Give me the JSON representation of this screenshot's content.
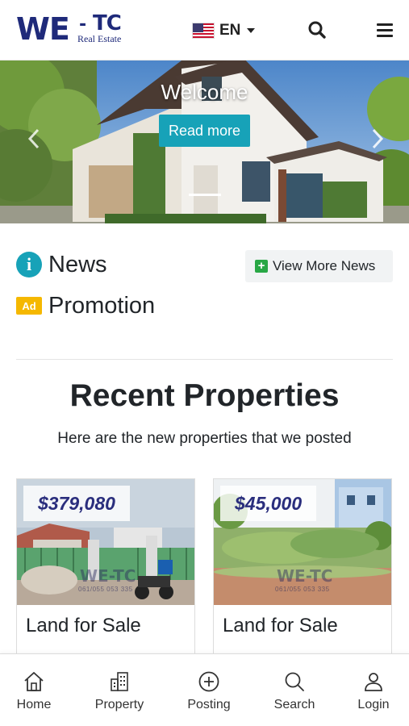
{
  "header": {
    "logo": {
      "main": "WE",
      "dash": "-",
      "tc": "TC",
      "sub": "Real Estate"
    },
    "language": {
      "selected": "EN",
      "flag": "us-flag"
    },
    "icons": {
      "search": "search-icon",
      "menu": "hamburger-menu-icon"
    }
  },
  "hero": {
    "title": "Welcome",
    "button_label": "Read more",
    "prev_icon": "chevron-left-icon",
    "next_icon": "chevron-right-icon"
  },
  "news": {
    "label": "News",
    "icon": "info-icon",
    "more_button": {
      "icon": "plus-square-icon",
      "label": "View More News"
    }
  },
  "promotion": {
    "label": "Promotion",
    "icon": {
      "name": "ad-icon",
      "text": "Ad"
    }
  },
  "recent": {
    "title": "Recent Properties",
    "subtitle": "Here are the new properties that we posted"
  },
  "properties": [
    {
      "price": "$379,080",
      "title": "Land for Sale",
      "watermark": "WE-TC",
      "watermark_sub": "061/055 053 335"
    },
    {
      "price": "$45,000",
      "title": "Land for Sale",
      "watermark": "WE-TC",
      "watermark_sub": "061/055 053 335"
    }
  ],
  "bottom_nav": [
    {
      "label": "Home",
      "icon": "home-icon"
    },
    {
      "label": "Property",
      "icon": "building-icon"
    },
    {
      "label": "Posting",
      "icon": "plus-circle-icon"
    },
    {
      "label": "Search",
      "icon": "search-icon"
    },
    {
      "label": "Login",
      "icon": "user-icon"
    }
  ],
  "colors": {
    "brand": "#1f2a7a",
    "accent": "#17a2b8",
    "success": "#28a745",
    "warning": "#f5b800",
    "price": "#2a2e7d"
  }
}
